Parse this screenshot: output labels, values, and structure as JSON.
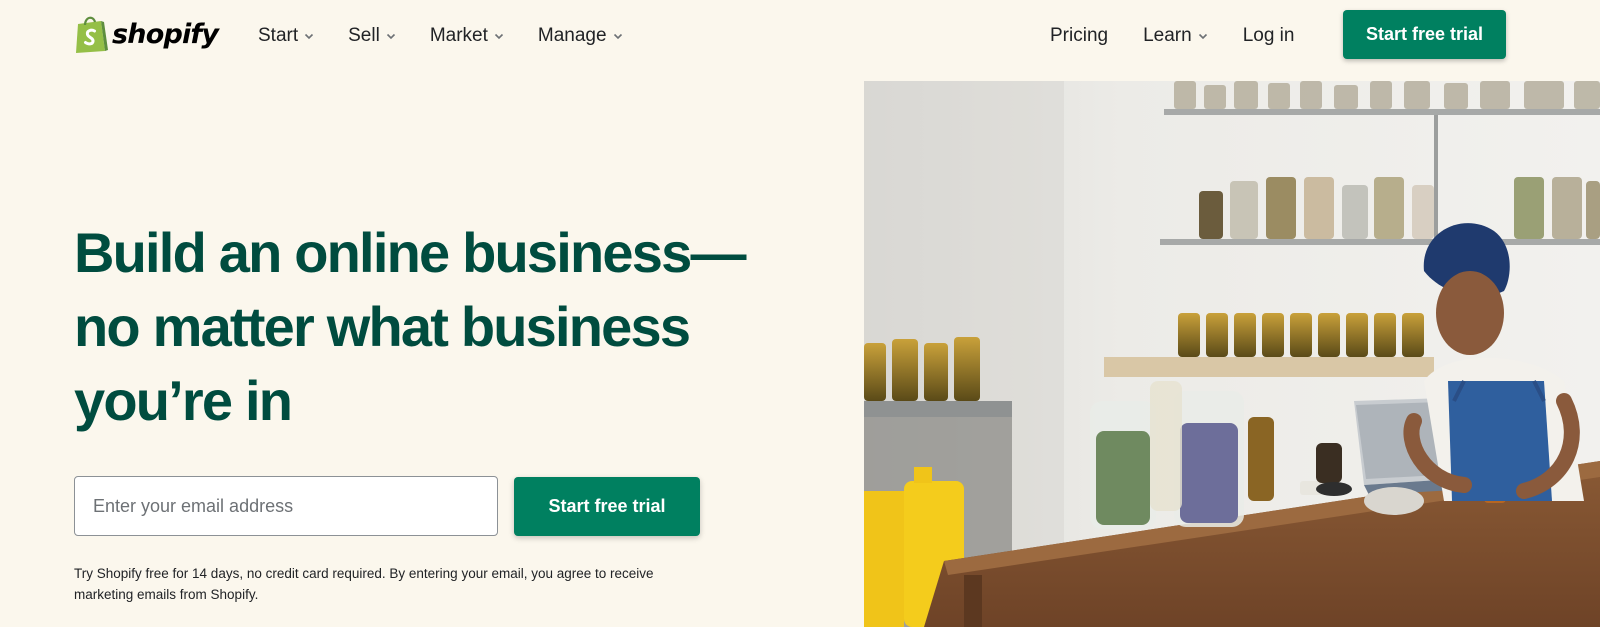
{
  "header": {
    "logo_text": "shopify",
    "nav_left": [
      {
        "label": "Start"
      },
      {
        "label": "Sell"
      },
      {
        "label": "Market"
      },
      {
        "label": "Manage"
      }
    ],
    "pricing_label": "Pricing",
    "learn_label": "Learn",
    "login_label": "Log in",
    "cta_label": "Start free trial"
  },
  "hero": {
    "title_line1": "Build an online business—",
    "title_line2": "no matter what business",
    "title_line3": "you’re in",
    "email_placeholder": "Enter your email address",
    "email_value": "",
    "cta_label": "Start free trial",
    "disclaimer_line1": "Try Shopify free for 14 days, no credit card required. By entering your email, you agree to receive",
    "disclaimer_line2": "marketing emails from Shopify."
  },
  "icons": {
    "logo": "shopping-bag-icon",
    "dropdown": "chevron-down-icon"
  },
  "colors": {
    "background": "#fbf7ed",
    "brand_green": "#008060",
    "heading_green": "#004c3f",
    "logo_green": "#95bf47"
  }
}
